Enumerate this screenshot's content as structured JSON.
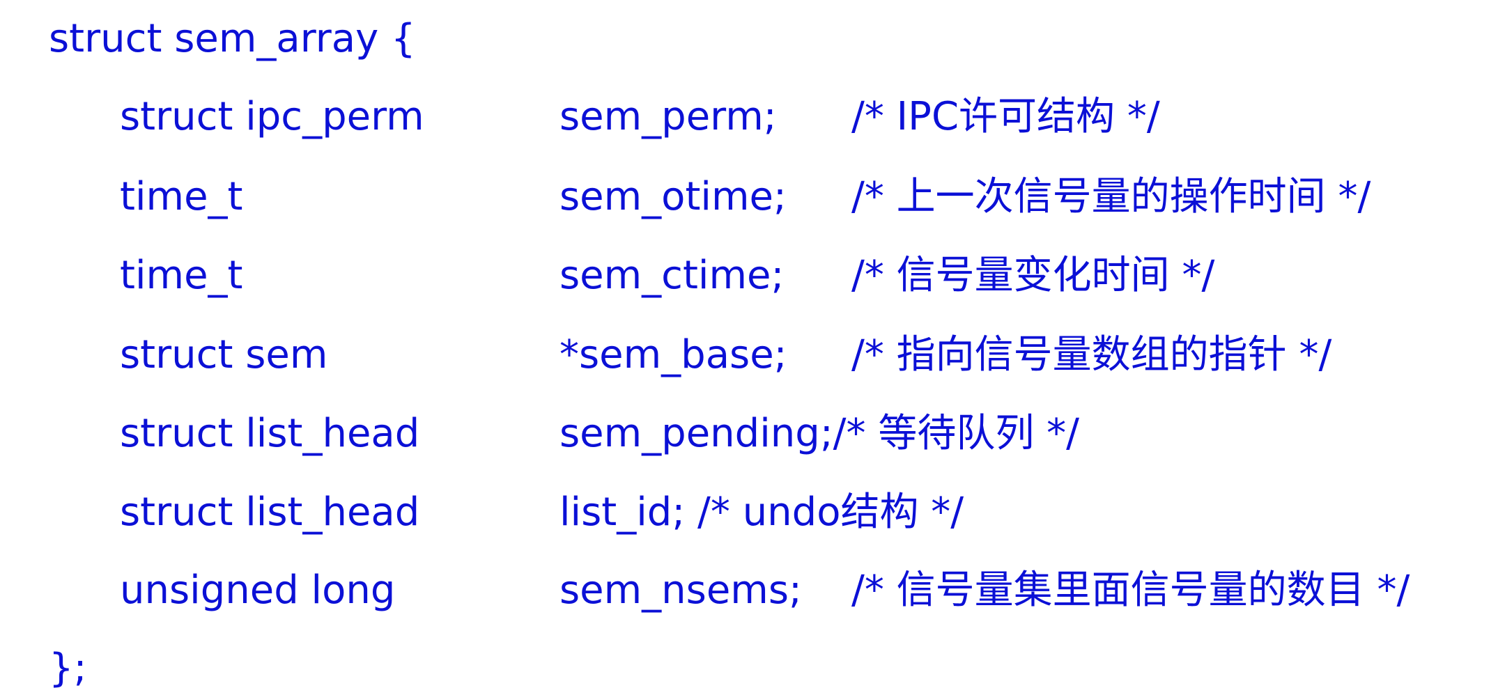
{
  "code": {
    "open_line": "struct sem_array {",
    "close_line": "};",
    "fields": [
      {
        "type": "struct ipc_perm",
        "name": "sem_perm;",
        "comment": "/* IPC许可结构 */"
      },
      {
        "type": "time_t",
        "name": "sem_otime;",
        "comment": "/* 上一次信号量的操作时间 */"
      },
      {
        "type": "time_t",
        "name": "sem_ctime;",
        "comment": "/* 信号量变化时间 */"
      },
      {
        "type": "struct sem",
        "name": "*sem_base;",
        "comment": "/* 指向信号量数组的指针 */"
      },
      {
        "type": "struct list_head",
        "name": "sem_pending;/* 等待队列 */"
      },
      {
        "type": "struct list_head",
        "name": "list_id; /* undo结构 */"
      },
      {
        "type": "unsigned long",
        "name": "sem_nsems;",
        "comment": "/* 信号量集里面信号量的数目 */"
      }
    ]
  },
  "colors": {
    "text": "#0b10d6",
    "background": "#ffffff"
  }
}
